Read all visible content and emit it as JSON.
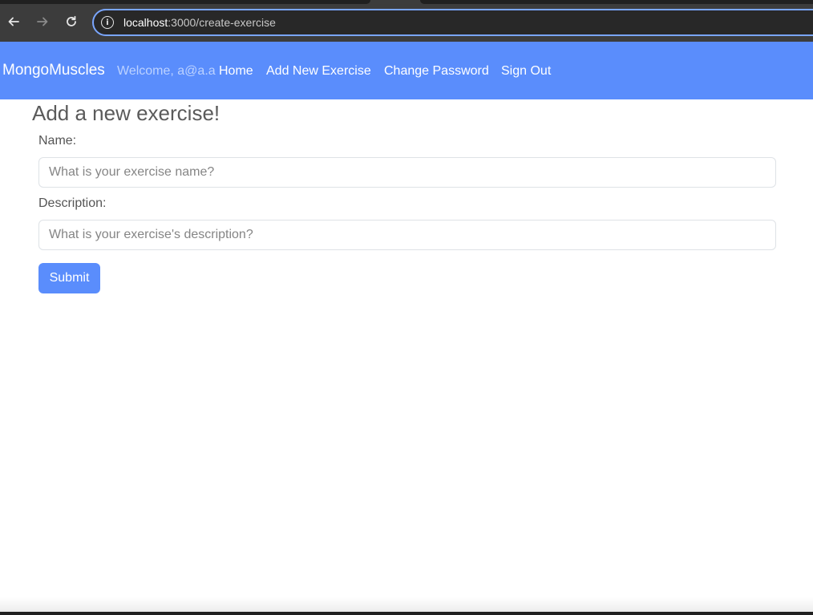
{
  "browser": {
    "url_host": "localhost",
    "url_path": ":3000/create-exercise",
    "back_icon": "arrow-left-icon",
    "forward_icon": "arrow-right-icon",
    "reload_icon": "reload-icon",
    "info_icon": "info-icon"
  },
  "navbar": {
    "brand": "MongoMuscles",
    "welcome": "Welcome, a@a.a",
    "links": [
      {
        "label": "Home"
      },
      {
        "label": "Add New Exercise"
      },
      {
        "label": "Change Password"
      },
      {
        "label": "Sign Out"
      }
    ],
    "color": "#5a8dfc"
  },
  "form": {
    "title": "Add a new exercise!",
    "name_label": "Name:",
    "name_placeholder": "What is your exercise name?",
    "name_value": "",
    "description_label": "Description:",
    "description_placeholder": "What is your exercise's description?",
    "description_value": "",
    "submit_label": "Submit"
  }
}
